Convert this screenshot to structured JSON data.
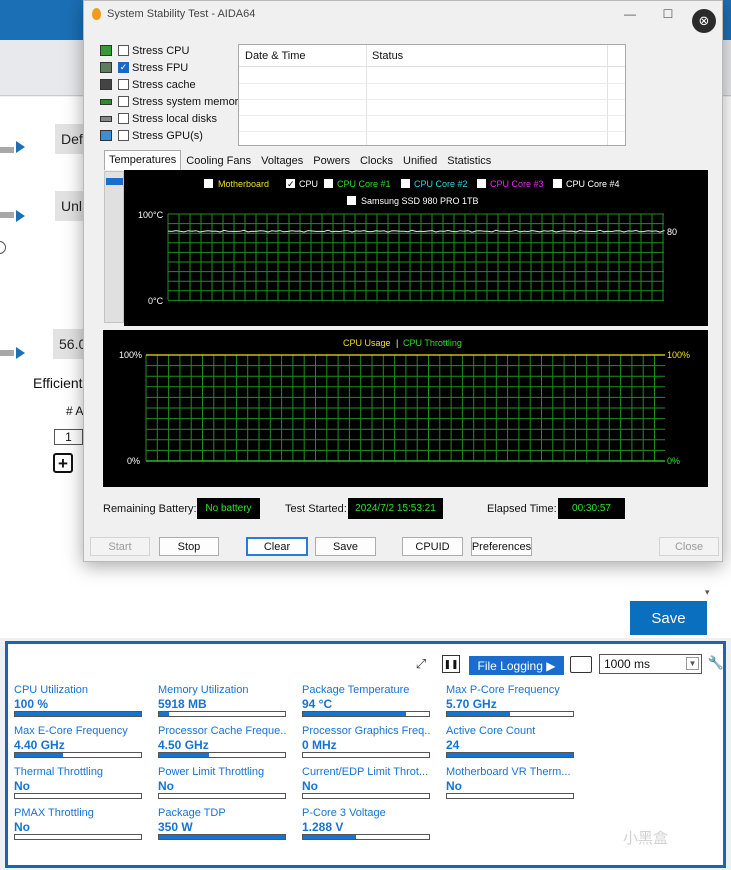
{
  "background": {
    "fields": [
      "Def",
      "Unl",
      "56.0"
    ],
    "efficient_label": "Efficient",
    "count_label": "# A",
    "count_value": "1",
    "save_label": "Save"
  },
  "aida": {
    "title": "System Stability Test - AIDA64",
    "options": [
      {
        "label": "Stress CPU",
        "checked": false
      },
      {
        "label": "Stress FPU",
        "checked": true
      },
      {
        "label": "Stress cache",
        "checked": false
      },
      {
        "label": "Stress system memory",
        "checked": false
      },
      {
        "label": "Stress local disks",
        "checked": false
      },
      {
        "label": "Stress GPU(s)",
        "checked": false
      }
    ],
    "table_headers": [
      "Date & Time",
      "Status"
    ],
    "tabs": [
      "Temperatures",
      "Cooling Fans",
      "Voltages",
      "Powers",
      "Clocks",
      "Unified",
      "Statistics"
    ],
    "temp_graph": {
      "legend": [
        {
          "label": "Motherboard",
          "checked": false,
          "color": "#f0e020"
        },
        {
          "label": "CPU",
          "checked": true,
          "color": "#ffffff"
        },
        {
          "label": "CPU Core #1",
          "checked": false,
          "color": "#28e028"
        },
        {
          "label": "CPU Core #2",
          "checked": false,
          "color": "#28d8e8"
        },
        {
          "label": "CPU Core #3",
          "checked": false,
          "color": "#e828e8"
        },
        {
          "label": "CPU Core #4",
          "checked": false,
          "color": "#ffffff"
        }
      ],
      "legend2": {
        "label": "Samsung SSD 980 PRO 1TB",
        "checked": false,
        "color": "#ffffff"
      },
      "y_top": "100°C",
      "y_bottom": "0°C",
      "current": "80"
    },
    "usage_graph": {
      "title_a": "CPU Usage",
      "separator": "|",
      "title_b": "CPU Throttling",
      "left_top": "100%",
      "left_bottom": "0%",
      "right_top": "100%",
      "right_bottom": "0%"
    },
    "remaining_battery_label": "Remaining Battery:",
    "remaining_battery": "No battery",
    "test_started_label": "Test Started:",
    "test_started": "2024/7/2 15:53:21",
    "elapsed_label": "Elapsed Time:",
    "elapsed": "00:30:57",
    "buttons": {
      "start": "Start",
      "stop": "Stop",
      "clear": "Clear",
      "save": "Save",
      "cpuid": "CPUID",
      "preferences": "Preferences",
      "close": "Close"
    }
  },
  "hwinfo": {
    "file_logging": "File Logging ▶",
    "interval": "1000 ms",
    "metrics": [
      {
        "label": "CPU Utilization",
        "value": "100 %",
        "fill": 1.0
      },
      {
        "label": "Memory Utilization",
        "value": "5918  MB",
        "fill": 0.08
      },
      {
        "label": "Package Temperature",
        "value": "94 °C",
        "fill": 0.82
      },
      {
        "label": "Max P-Core Frequency",
        "value": "5.70 GHz",
        "fill": 0.5
      },
      {
        "label": "Max E-Core Frequency",
        "value": "4.40 GHz",
        "fill": 0.38
      },
      {
        "label": "Processor Cache Freque...",
        "value": "4.50 GHz",
        "fill": 0.4
      },
      {
        "label": "Processor Graphics Freq...",
        "value": "0 MHz",
        "fill": 0
      },
      {
        "label": "Active Core Count",
        "value": "24",
        "fill": 1.0
      },
      {
        "label": "Thermal Throttling",
        "value": "No",
        "fill": 0
      },
      {
        "label": "Power Limit Throttling",
        "value": "No",
        "fill": 0
      },
      {
        "label": "Current/EDP Limit Throt...",
        "value": "No",
        "fill": 0
      },
      {
        "label": "Motherboard VR Therm...",
        "value": "No",
        "fill": 0
      },
      {
        "label": "PMAX Throttling",
        "value": "No",
        "fill": 0
      },
      {
        "label": "Package TDP",
        "value": "350 W",
        "fill": 1.0
      },
      {
        "label": "P-Core 3 Voltage",
        "value": "1.288 V",
        "fill": 0.42
      }
    ],
    "watermark": "小黑盒"
  }
}
